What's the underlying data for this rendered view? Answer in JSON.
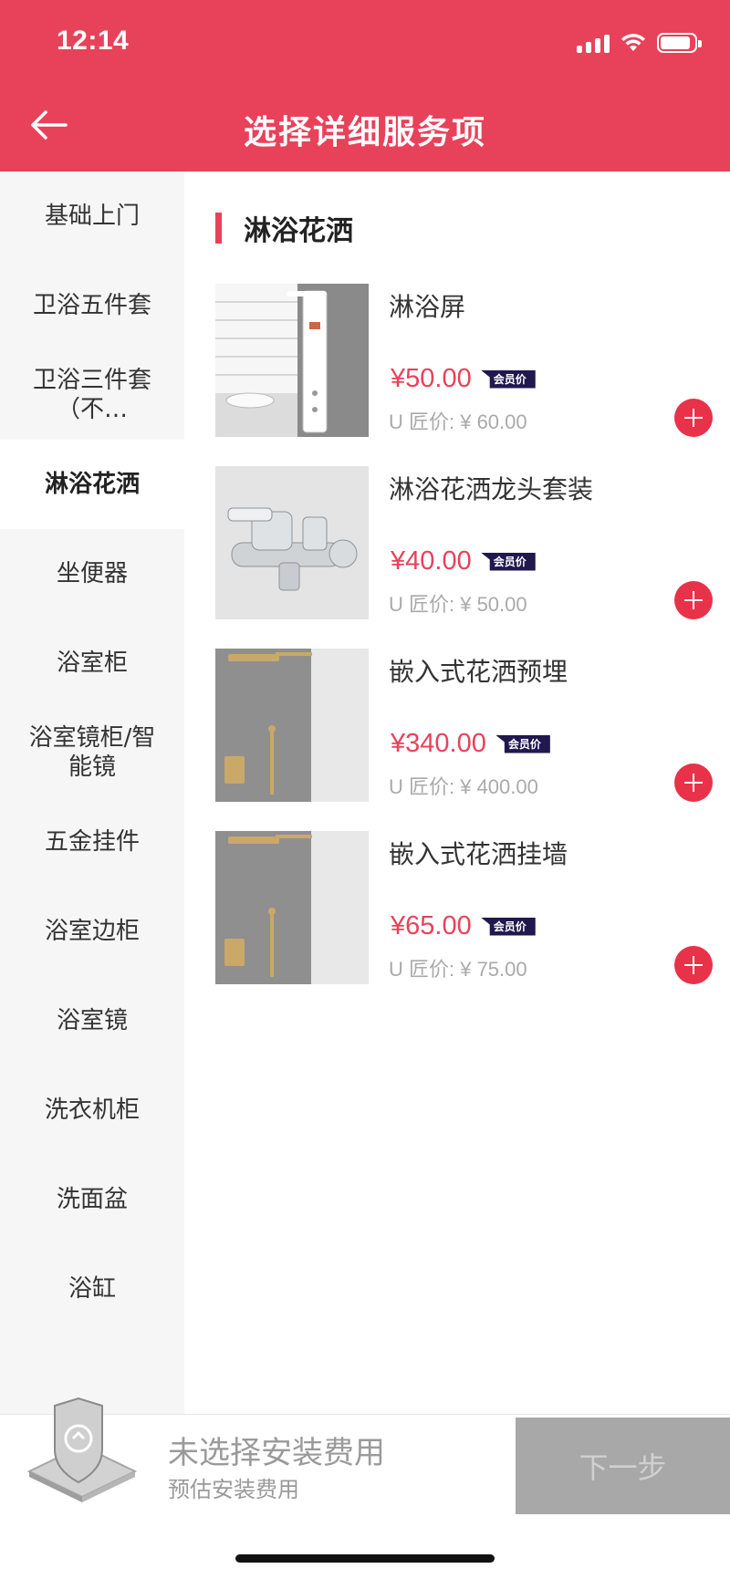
{
  "status_bar": {
    "time": "12:14"
  },
  "header": {
    "title": "选择详细服务项"
  },
  "sidebar": {
    "items": [
      {
        "label": "基础上门"
      },
      {
        "label": "卫浴五件套"
      },
      {
        "label": "卫浴三件套（不…"
      },
      {
        "label": "淋浴花洒",
        "active": true
      },
      {
        "label": "坐便器"
      },
      {
        "label": "浴室柜"
      },
      {
        "label": "浴室镜柜/智能镜"
      },
      {
        "label": "五金挂件"
      },
      {
        "label": "浴室边柜"
      },
      {
        "label": "浴室镜"
      },
      {
        "label": "洗衣机柜"
      },
      {
        "label": "洗面盆"
      },
      {
        "label": "浴缸"
      }
    ]
  },
  "main": {
    "section_title": "淋浴花洒",
    "products": [
      {
        "name": "淋浴屏",
        "price": "¥50.00",
        "member_tag": "会员价",
        "orig_price": "U 匠价: ¥ 60.00",
        "image": "shower-panel-image"
      },
      {
        "name": "淋浴花洒龙头套装",
        "price": "¥40.00",
        "member_tag": "会员价",
        "orig_price": "U 匠价: ¥ 50.00",
        "image": "faucet-set-image"
      },
      {
        "name": "嵌入式花洒预埋",
        "price": "¥340.00",
        "member_tag": "会员价",
        "orig_price": "U 匠价: ¥ 400.00",
        "image": "embedded-shower-image"
      },
      {
        "name": "嵌入式花洒挂墙",
        "price": "¥65.00",
        "member_tag": "会员价",
        "orig_price": "U 匠价: ¥ 75.00",
        "image": "wall-shower-image"
      }
    ]
  },
  "bottom_bar": {
    "fee_title": "未选择安装费用",
    "fee_subtitle": "预估安装费用",
    "next_label": "下一步"
  },
  "colors": {
    "brand": "#e8425a",
    "member_tag_bg": "#20184e",
    "disabled_button": "#a8a8a8"
  }
}
